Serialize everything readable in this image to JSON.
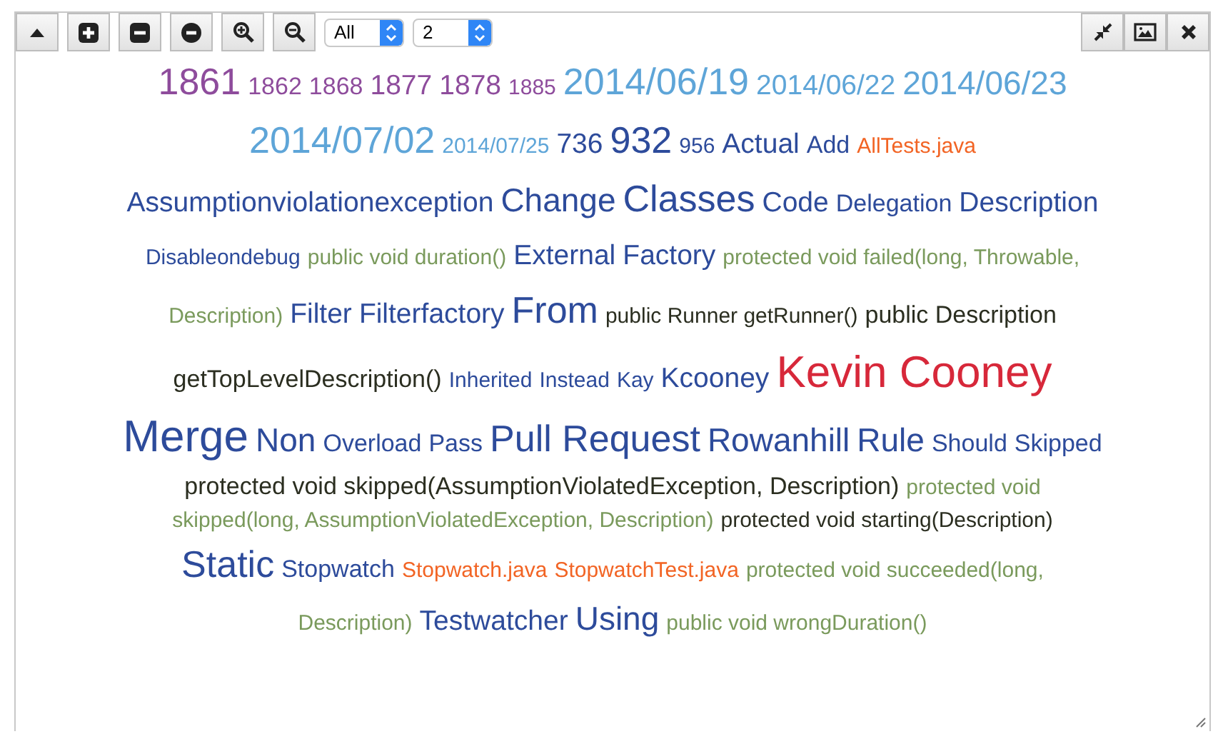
{
  "toolbar": {
    "filters": [
      {
        "value": "All"
      },
      {
        "value": "2"
      }
    ]
  },
  "rows": [
    [
      {
        "text": "1861",
        "kind": "huge",
        "color": "#8e4c9c"
      },
      {
        "text": "1862",
        "kind": "small",
        "color": "#8e4c9c"
      },
      {
        "text": "1868",
        "kind": "small",
        "color": "#8e4c9c"
      },
      {
        "text": "1877",
        "kind": "medium",
        "color": "#8e4c9c"
      },
      {
        "text": "1878",
        "kind": "medium",
        "color": "#8e4c9c"
      },
      {
        "text": "1885",
        "kind": "tiny",
        "color": "#8e4c9c"
      },
      {
        "text": "2014/06/19",
        "kind": "huge",
        "color": "#5ea5d8"
      },
      {
        "text": "2014/06/22",
        "kind": "medium",
        "color": "#5ea5d8"
      },
      {
        "text": "2014/06/23",
        "kind": "large",
        "color": "#5ea5d8"
      }
    ],
    [
      {
        "text": "2014/07/02",
        "kind": "huge",
        "color": "#5ea5d8"
      },
      {
        "text": "2014/07/25",
        "kind": "tiny",
        "color": "#5ea5d8"
      },
      {
        "text": "736",
        "kind": "medium",
        "color": "#2d4b9b"
      },
      {
        "text": "932",
        "kind": "huge",
        "color": "#2d4b9b"
      },
      {
        "text": "956",
        "kind": "tiny",
        "color": "#2d4b9b"
      },
      {
        "text": "Actual",
        "kind": "medium",
        "color": "#2d4b9b"
      },
      {
        "text": "Add",
        "kind": "small",
        "color": "#2d4b9b"
      },
      {
        "text": "AllTests.java",
        "kind": "tiny",
        "color": "#f26424"
      }
    ],
    [
      {
        "text": "Assumptionviolationexception",
        "kind": "medium",
        "color": "#2d4b9b"
      },
      {
        "text": "Change",
        "kind": "large",
        "color": "#2d4b9b"
      },
      {
        "text": "Classes",
        "kind": "huge",
        "color": "#2d4b9b"
      },
      {
        "text": "Code",
        "kind": "medium",
        "color": "#2d4b9b"
      },
      {
        "text": "Delegation",
        "kind": "small",
        "color": "#2d4b9b"
      },
      {
        "text": "Description",
        "kind": "medium",
        "color": "#2d4b9b"
      }
    ],
    [
      {
        "text": "Disableondebug",
        "kind": "tiny",
        "color": "#2d4b9b"
      },
      {
        "text": "public void duration()",
        "kind": "tiny",
        "color": "#7a9a5c"
      },
      {
        "text": "External",
        "kind": "medium",
        "color": "#2d4b9b"
      },
      {
        "text": "Factory",
        "kind": "medium",
        "color": "#2d4b9b"
      },
      {
        "text": "protected void failed(long, Throwable,",
        "kind": "tiny",
        "color": "#7a9a5c"
      }
    ],
    [
      {
        "text": "Description)",
        "kind": "tiny",
        "color": "#7a9a5c"
      },
      {
        "text": "Filter",
        "kind": "medium",
        "color": "#2d4b9b"
      },
      {
        "text": "Filterfactory",
        "kind": "medium",
        "color": "#2d4b9b"
      },
      {
        "text": "From",
        "kind": "huge",
        "color": "#2d4b9b"
      },
      {
        "text": "public Runner getRunner()",
        "kind": "tiny",
        "color": "#2b2e20"
      },
      {
        "text": "public Description",
        "kind": "small",
        "color": "#2b2e20"
      }
    ],
    [
      {
        "text": "getTopLevelDescription()",
        "kind": "small",
        "color": "#2b2e20"
      },
      {
        "text": "Inherited",
        "kind": "tiny",
        "color": "#2d4b9b"
      },
      {
        "text": "Instead",
        "kind": "tiny",
        "color": "#2d4b9b"
      },
      {
        "text": "Kay",
        "kind": "tiny",
        "color": "#2d4b9b"
      },
      {
        "text": "Kcooney",
        "kind": "medium",
        "color": "#2d4b9b"
      },
      {
        "text": "Kevin Cooney",
        "kind": "giant",
        "color": "#d7283a"
      }
    ],
    [
      {
        "text": "Merge",
        "kind": "giant",
        "color": "#2d4b9b"
      },
      {
        "text": "Non",
        "kind": "large",
        "color": "#2d4b9b"
      },
      {
        "text": "Overload",
        "kind": "small",
        "color": "#2d4b9b"
      },
      {
        "text": "Pass",
        "kind": "small",
        "color": "#2d4b9b"
      },
      {
        "text": "Pull Request",
        "kind": "huge",
        "color": "#2d4b9b"
      },
      {
        "text": "Rowanhill",
        "kind": "large",
        "color": "#2d4b9b"
      },
      {
        "text": "Rule",
        "kind": "large",
        "color": "#2d4b9b"
      },
      {
        "text": "Should",
        "kind": "small",
        "color": "#2d4b9b"
      },
      {
        "text": "Skipped",
        "kind": "small",
        "color": "#2d4b9b"
      }
    ],
    [
      {
        "text": "protected void skipped(AssumptionViolatedException, Description)",
        "kind": "small",
        "color": "#2b2e20"
      },
      {
        "text": "protected void",
        "kind": "tiny",
        "color": "#7a9a5c"
      }
    ],
    [
      {
        "text": "skipped(long, AssumptionViolatedException, Description)",
        "kind": "tiny",
        "color": "#7a9a5c"
      },
      {
        "text": "protected void starting(Description)",
        "kind": "tiny",
        "color": "#2b2e20"
      }
    ],
    [
      {
        "text": "Static",
        "kind": "huge",
        "color": "#2d4b9b"
      },
      {
        "text": "Stopwatch",
        "kind": "small",
        "color": "#2d4b9b"
      },
      {
        "text": "Stopwatch.java",
        "kind": "tiny",
        "color": "#f26424"
      },
      {
        "text": "StopwatchTest.java",
        "kind": "tiny",
        "color": "#f26424"
      },
      {
        "text": "protected void succeeded(long,",
        "kind": "tiny",
        "color": "#7a9a5c"
      }
    ],
    [
      {
        "text": "Description)",
        "kind": "tiny",
        "color": "#7a9a5c"
      },
      {
        "text": "Testwatcher",
        "kind": "medium",
        "color": "#2d4b9b"
      },
      {
        "text": "Using",
        "kind": "large",
        "color": "#2d4b9b"
      },
      {
        "text": "public void wrongDuration()",
        "kind": "tiny",
        "color": "#7a9a5c"
      }
    ]
  ]
}
